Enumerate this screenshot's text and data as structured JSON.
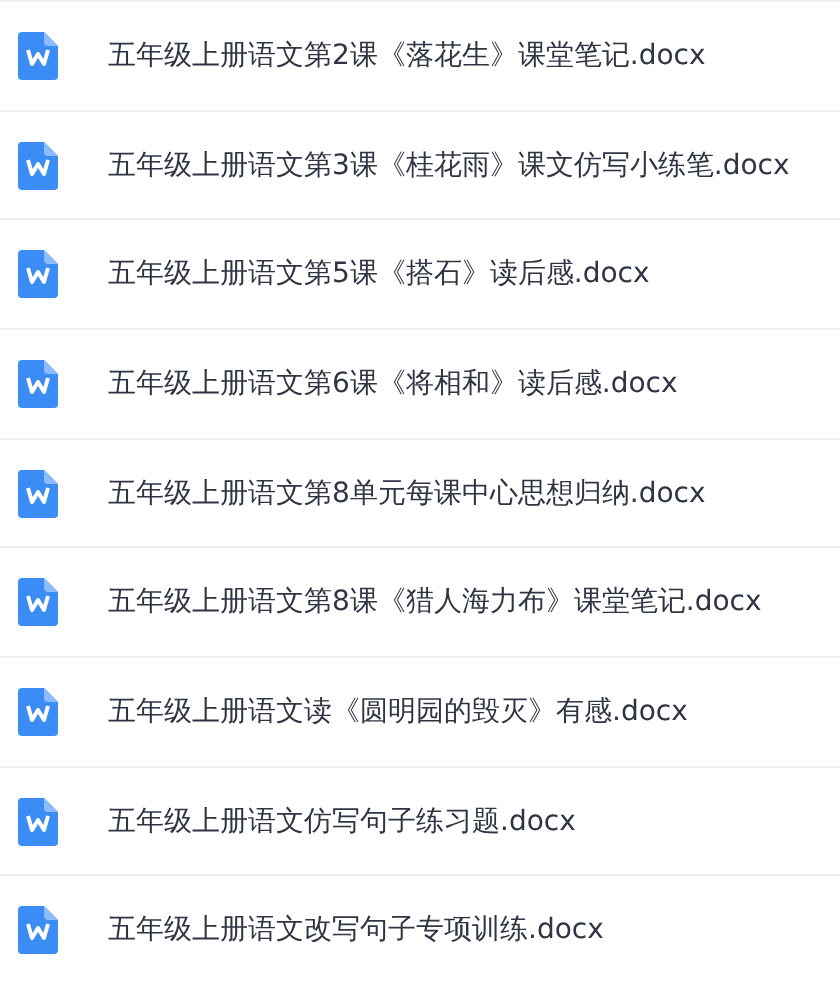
{
  "files": [
    {
      "name": "五年级上册语文第2课《落花生》课堂笔记.docx",
      "kind": "word"
    },
    {
      "name": "五年级上册语文第3课《桂花雨》课文仿写小练笔.docx",
      "kind": "word"
    },
    {
      "name": "五年级上册语文第5课《搭石》读后感.docx",
      "kind": "word"
    },
    {
      "name": "五年级上册语文第6课《将相和》读后感.docx",
      "kind": "word"
    },
    {
      "name": "五年级上册语文第8单元每课中心思想归纳.docx",
      "kind": "word"
    },
    {
      "name": "五年级上册语文第8课《猎人海力布》课堂笔记.docx",
      "kind": "word"
    },
    {
      "name": "五年级上册语文读《圆明园的毁灭》有感.docx",
      "kind": "word"
    },
    {
      "name": "五年级上册语文仿写句子练习题.docx",
      "kind": "word"
    },
    {
      "name": "五年级上册语文改写句子专项训练.docx",
      "kind": "word"
    }
  ]
}
